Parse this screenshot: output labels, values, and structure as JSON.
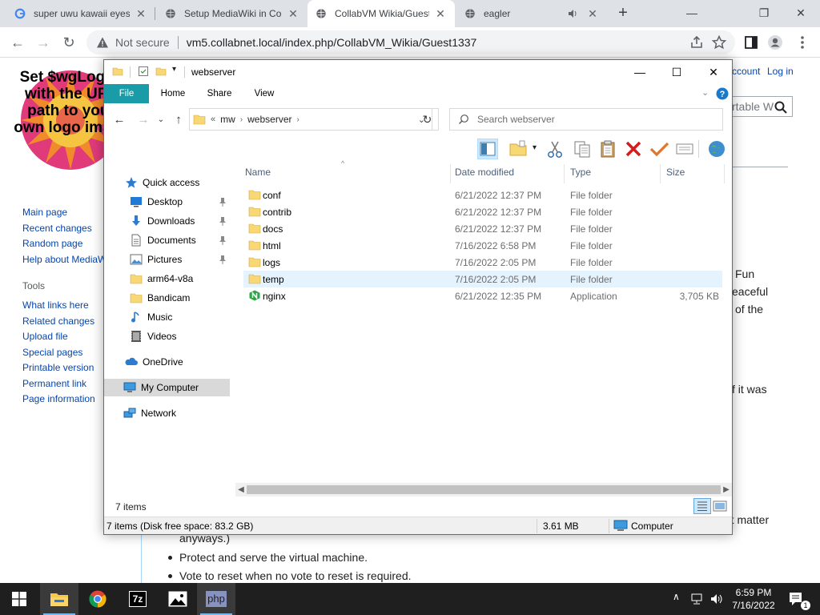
{
  "browser": {
    "tabs": [
      {
        "title": "super uwu kawaii eyes",
        "active": false
      },
      {
        "title": "Setup MediaWiki in Co",
        "active": false
      },
      {
        "title": "CollabVM Wikia/Guest",
        "active": true
      },
      {
        "title": "eagler",
        "active": false
      }
    ],
    "not_secure": "Not secure",
    "url": "vm5.collabnet.local/index.php/CollabVM_Wikia/Guest1337"
  },
  "wiki": {
    "logo_text": "Set $wgLogos with the URL path to your own logo image",
    "personal": {
      "account": "ccount",
      "login": "Log in"
    },
    "search_placeholder": "rtable W",
    "nav_links": [
      "Main page",
      "Recent changes",
      "Random page",
      "Help about MediaWiki"
    ],
    "tools_heading": "Tools",
    "tool_links": [
      "What links here",
      "Related changes",
      "Upload file",
      "Special pages",
      "Printable version",
      "Permanent link",
      "Page information"
    ],
    "fragments": {
      "fun": "Fun",
      "peaceful": "eaceful",
      "ofthe": "of the",
      "ifitwas": "f it was",
      "matter": "'t matter"
    },
    "anyways": "anyways.)",
    "bullets": [
      "Protect and serve the virtual machine.",
      "Vote to reset when no vote to reset is required."
    ]
  },
  "explorer": {
    "title": "webserver",
    "ribbon_tabs": [
      "File",
      "Home",
      "Share",
      "View"
    ],
    "breadcrumb": [
      "«",
      "mw",
      "webserver"
    ],
    "search_placeholder": "Search webserver",
    "nav": [
      {
        "label": "Quick access",
        "icon": "star-icon",
        "indent": 0,
        "pinned": false
      },
      {
        "label": "Desktop",
        "icon": "desktop-icon",
        "indent": 1,
        "pinned": true
      },
      {
        "label": "Downloads",
        "icon": "download-icon",
        "indent": 1,
        "pinned": true
      },
      {
        "label": "Documents",
        "icon": "document-icon",
        "indent": 1,
        "pinned": true
      },
      {
        "label": "Pictures",
        "icon": "pictures-icon",
        "indent": 1,
        "pinned": true
      },
      {
        "label": "arm64-v8a",
        "icon": "folder-icon",
        "indent": 1,
        "pinned": false
      },
      {
        "label": "Bandicam",
        "icon": "folder-icon",
        "indent": 1,
        "pinned": false
      },
      {
        "label": "Music",
        "icon": "music-icon",
        "indent": 1,
        "pinned": false
      },
      {
        "label": "Videos",
        "icon": "video-icon",
        "indent": 1,
        "pinned": false
      },
      {
        "label": "OneDrive",
        "icon": "cloud-icon",
        "indent": 0,
        "pinned": false
      },
      {
        "label": "My Computer",
        "icon": "computer-icon",
        "indent": 0,
        "pinned": false,
        "selected": true
      },
      {
        "label": "Network",
        "icon": "network-icon",
        "indent": 0,
        "pinned": false
      }
    ],
    "columns": [
      "Name",
      "Date modified",
      "Type",
      "Size"
    ],
    "files": [
      {
        "name": "conf",
        "date": "6/21/2022 12:37 PM",
        "type": "File folder",
        "size": ""
      },
      {
        "name": "contrib",
        "date": "6/21/2022 12:37 PM",
        "type": "File folder",
        "size": ""
      },
      {
        "name": "docs",
        "date": "6/21/2022 12:37 PM",
        "type": "File folder",
        "size": ""
      },
      {
        "name": "html",
        "date": "7/16/2022 6:58 PM",
        "type": "File folder",
        "size": ""
      },
      {
        "name": "logs",
        "date": "7/16/2022 2:05 PM",
        "type": "File folder",
        "size": ""
      },
      {
        "name": "temp",
        "date": "7/16/2022 2:05 PM",
        "type": "File folder",
        "size": "",
        "hover": true
      },
      {
        "name": "nginx",
        "date": "6/21/2022 12:35 PM",
        "type": "Application",
        "size": "3,705 KB",
        "app": true
      }
    ],
    "item_count": "7 items",
    "status_left": "7 items (Disk free space: 83.2 GB)",
    "status_size": "3.61 MB",
    "status_location": "Computer"
  },
  "taskbar": {
    "apps": [
      "file-explorer-icon",
      "chrome-icon",
      "7zip-icon",
      "photos-icon",
      "php-icon"
    ],
    "app_labels": {
      "7zip": "7z",
      "php": "php"
    },
    "time": "6:59 PM",
    "date": "7/16/2022",
    "notification_count": "1"
  },
  "colors": {
    "accent": "#1a9ba8",
    "link": "#0645ad",
    "taskbar": "#1f1f1f"
  }
}
